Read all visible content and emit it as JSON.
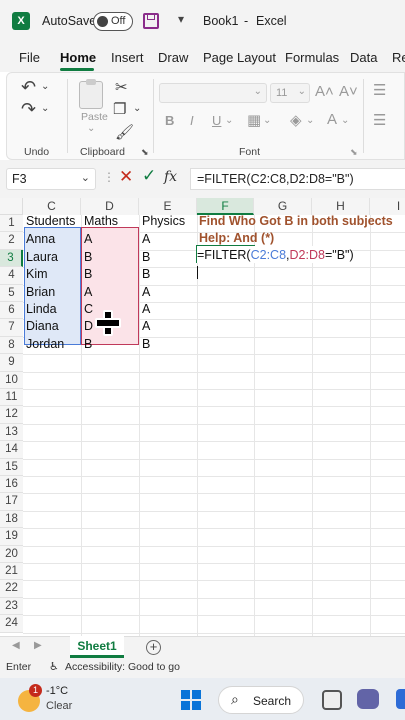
{
  "titlebar": {
    "app_icon": "excel-icon",
    "autosave_label": "AutoSave",
    "toggle_state": "Off",
    "doc_title": "Book1",
    "separator": "-",
    "app_name": "Excel"
  },
  "ribbon_tabs": [
    "File",
    "Home",
    "Insert",
    "Draw",
    "Page Layout",
    "Formulas",
    "Data",
    "Re"
  ],
  "ribbon_groups": {
    "undo": "Undo",
    "clipboard": "Clipboard",
    "paste": "Paste",
    "font": "Font",
    "font_size": "11"
  },
  "formula_bar": {
    "name_box": "F3",
    "fx": "fx",
    "formula": "=FILTER(C2:C8,D2:D8=\"B\")"
  },
  "columns": [
    "C",
    "D",
    "E",
    "F",
    "G",
    "H",
    "I"
  ],
  "rows": [
    "1",
    "2",
    "3",
    "4",
    "5",
    "6",
    "7",
    "8",
    "9",
    "10",
    "11",
    "12",
    "13",
    "14",
    "15",
    "16",
    "17",
    "18",
    "19",
    "20",
    "21",
    "22",
    "23",
    "24"
  ],
  "headers": {
    "students": "Students",
    "maths": "Maths",
    "physics": "Physics"
  },
  "students": [
    "Anna",
    "Laura",
    "Kim",
    "Brian",
    "Linda",
    "Diana",
    "Jordan"
  ],
  "maths": [
    "A",
    "B",
    "B",
    "A",
    "C",
    "D",
    "B"
  ],
  "physics": [
    "A",
    "B",
    "B",
    "A",
    "A",
    "A",
    "B"
  ],
  "notes": {
    "title": "Find Who Got B in both subjects",
    "help": "Help: And (*)"
  },
  "editing_formula": {
    "p1": "=FILTER(",
    "p2": "C2:C8",
    ",": ",",
    "p3": "D2:D8",
    "p4": "=\"B\")"
  },
  "sheet_tab": "Sheet1",
  "status": {
    "mode": "Enter",
    "accessibility": "Accessibility: Good to go"
  },
  "taskbar": {
    "weather_badge": "1",
    "temp": "-1°C",
    "condition": "Clear",
    "search": "Search"
  },
  "colors": {
    "excel_green": "#107c41",
    "maths_range": "#c0395a",
    "students_range": "#4a7bd8",
    "note_color": "#a0522d"
  }
}
